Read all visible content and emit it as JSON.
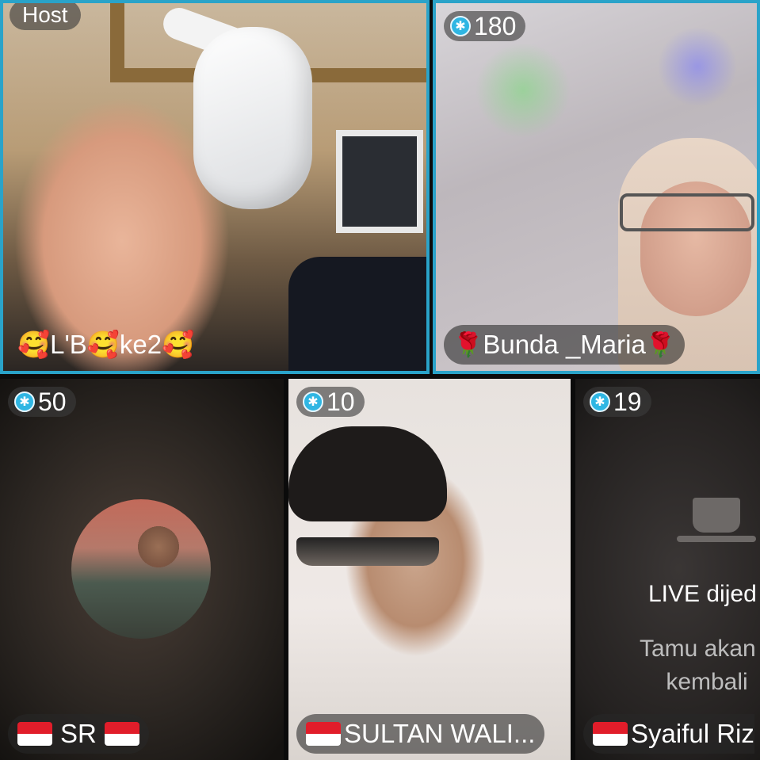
{
  "tiles": [
    {
      "badge": "Host",
      "name": "🥰L'B🥰ke2🥰"
    },
    {
      "badge": "180",
      "name": "Bunda _Maria",
      "name_emoji": "🌹"
    },
    {
      "badge": "50",
      "name": "SR"
    },
    {
      "badge": "10",
      "name": "SULTAN WALI..."
    },
    {
      "badge": "19",
      "name": "Syaiful Riz",
      "status_title": "LIVE dijed",
      "status_sub_1": "Tamu akan s",
      "status_sub_2": "kembali"
    }
  ],
  "colors": {
    "host_border": "#2aa3c9",
    "gem": "#2fb6e3",
    "flag_red": "#e11d2a"
  },
  "icons": {
    "gem": "diamond-coin-icon",
    "flag": "indonesia-flag-icon",
    "cup": "coffee-cup-icon"
  }
}
